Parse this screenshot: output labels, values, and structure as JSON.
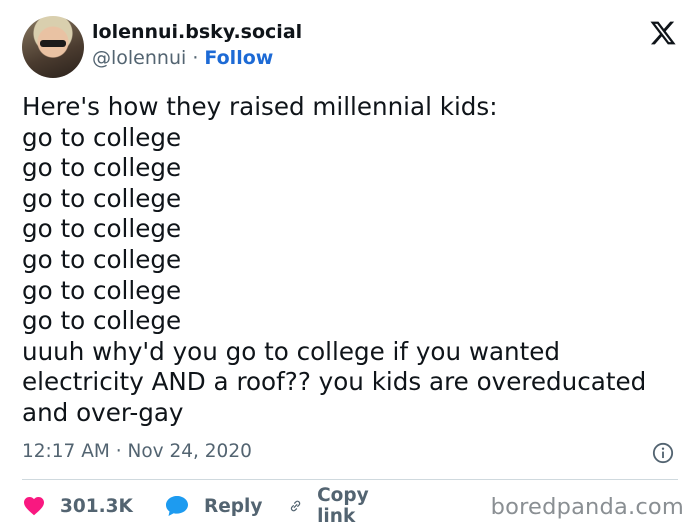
{
  "author": {
    "display_name": "lolennui.bsky.social",
    "handle": "@lolennui",
    "separator": "·",
    "follow_label": "Follow"
  },
  "post": {
    "lines": [
      "Here's how they raised millennial kids:",
      "go to college",
      "go to college",
      "go to college",
      "go to college",
      "go to college",
      "go to college",
      "go to college",
      "uuuh why'd you go to college if you wanted",
      "electricity AND a roof?? you kids are overeducated",
      "and over-gay"
    ],
    "time": "12:17 AM",
    "date_separator": "·",
    "date": "Nov 24, 2020"
  },
  "actions": {
    "like_count": "301.3K",
    "reply_label": "Reply",
    "copy_link_label": "Copy link"
  },
  "watermark": "boredpanda.com",
  "colors": {
    "text": "#0f1419",
    "muted": "#536471",
    "follow": "#1d6ad5",
    "like": "#f91880",
    "reply": "#1d9bf0",
    "divider": "#cfd9de"
  },
  "icons": [
    "x-logo-icon",
    "info-icon",
    "heart-icon",
    "reply-bubble-icon",
    "link-icon"
  ]
}
